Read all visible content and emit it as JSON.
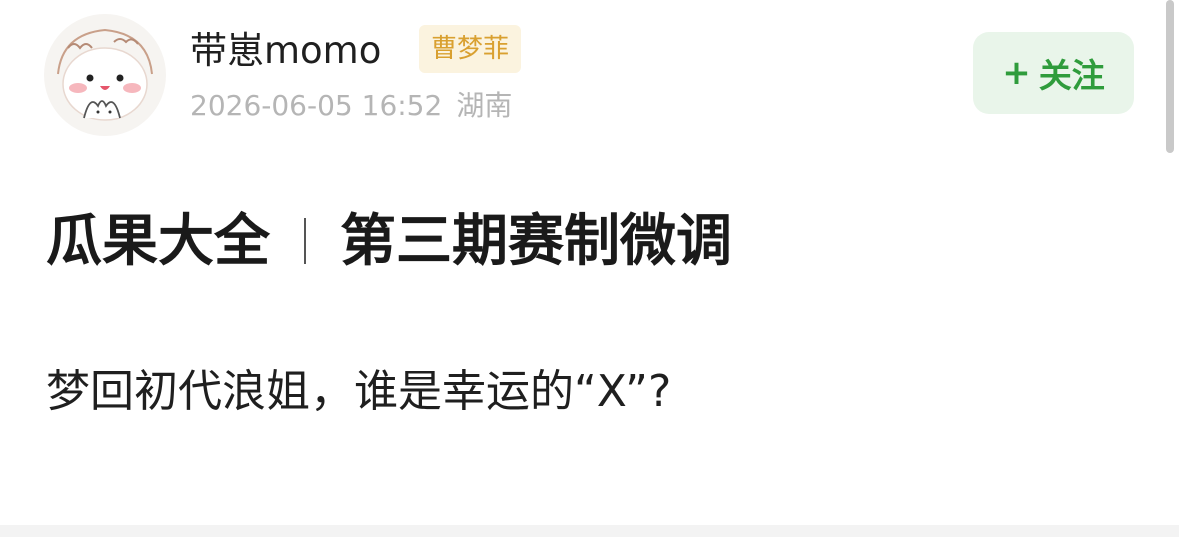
{
  "post": {
    "author": {
      "name": "带崽momo",
      "tag": "曹梦菲",
      "avatar_icon": "cartoon-avatar-icon"
    },
    "timestamp": "2026-06-05 16:52",
    "location": "湖南",
    "follow_button": {
      "plus": "+",
      "label": "关注"
    },
    "title_left": "瓜果大全",
    "title_right": "第三期赛制微调",
    "body": "梦回初代浪姐，谁是幸运的“X”?"
  },
  "colors": {
    "follow_bg": "#e9f5ea",
    "follow_text": "#2f9c3c",
    "tag_bg": "#fbf3df",
    "tag_text": "#d9a030",
    "meta_text": "#b5b5b5"
  }
}
